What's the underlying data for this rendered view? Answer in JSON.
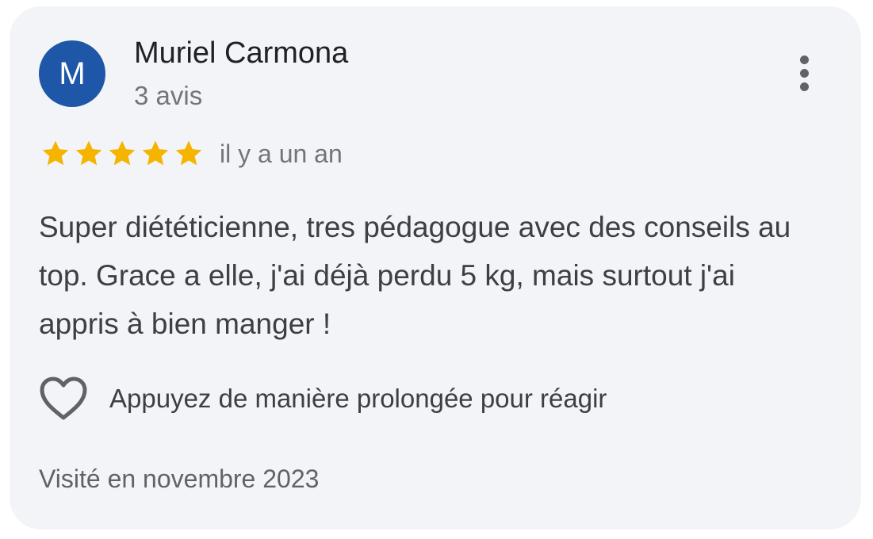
{
  "review": {
    "author": {
      "initial": "M",
      "name": "Muriel Carmona",
      "review_count": "3 avis",
      "avatar_color": "#1f57a8"
    },
    "more_icon": "more-vert-icon",
    "rating": {
      "value": 5,
      "max": 5,
      "star_color": "#f4b400",
      "star_icon": "star-icon"
    },
    "time_ago": "il y a un an",
    "text": "Super diététicienne, tres pédagogue avec des conseils au top. Grace a elle, j'ai déjà perdu 5 kg, mais surtout j'ai appris à bien manger !",
    "reaction": {
      "icon": "heart-outline-icon",
      "label": "Appuyez de manière prolongée pour réagir"
    },
    "visit": "Visité en novembre 2023"
  },
  "colors": {
    "card_background": "#f3f4f7",
    "primary_text": "#202124",
    "secondary_text": "#70757a"
  }
}
